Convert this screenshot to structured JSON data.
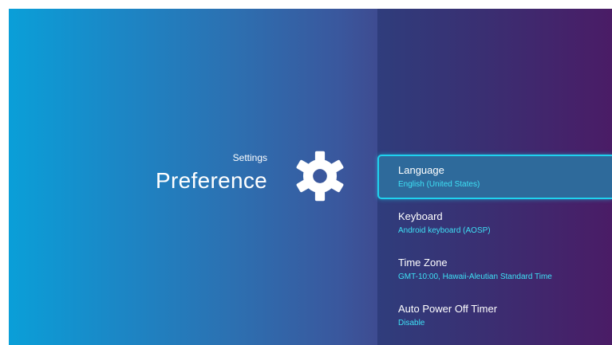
{
  "header": {
    "breadcrumb": "Settings",
    "title": "Preference",
    "icon": "gear-icon"
  },
  "menu": {
    "items": [
      {
        "label": "Language",
        "value": "English (United States)",
        "selected": true
      },
      {
        "label": "Keyboard",
        "value": "Android keyboard (AOSP)",
        "selected": false
      },
      {
        "label": "Time Zone",
        "value": "GMT-10:00, Hawaii-Aleutian Standard Time",
        "selected": false
      },
      {
        "label": "Auto Power Off Timer",
        "value": "Disable",
        "selected": false
      }
    ]
  },
  "colors": {
    "accent": "#1fd2ef",
    "value_text": "#3ee0f5",
    "selected_bg": "#2e6a9b"
  }
}
